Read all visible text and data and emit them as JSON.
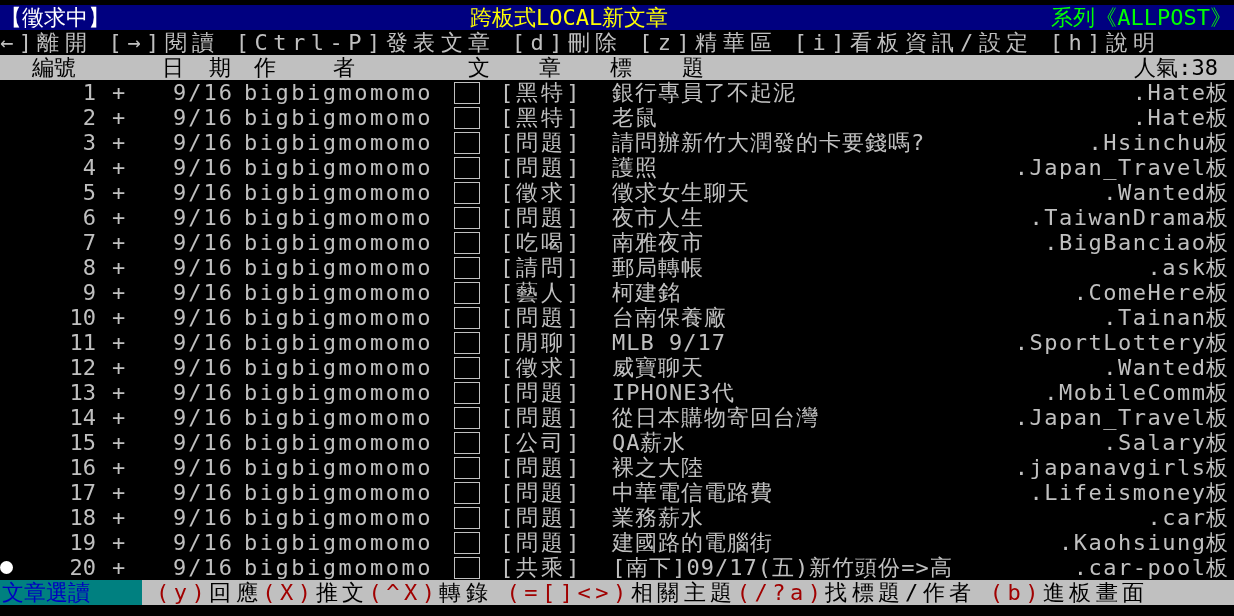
{
  "title_bar": {
    "mode": "【徵求中】",
    "title": "跨板式LOCAL新文章",
    "series": "系列《ALLPOST》"
  },
  "nav": [
    "←]離開",
    "[→]閱讀",
    "[Ctrl-P]發表文章",
    "[d]刪除",
    "[z]精華區",
    "[i]看板資訊/設定",
    "[h]說明"
  ],
  "columns": {
    "number": "編號",
    "date": "日 期",
    "author": "作 者",
    "title": "文 章 標 題",
    "popularity": "人氣:38"
  },
  "rows": [
    {
      "number": "1",
      "mark": "+",
      "date": "9/16",
      "author": "bigbigmomomo",
      "category": "[黑特]",
      "title": "銀行專員了不起泥",
      "board": ".Hate板",
      "selected": false
    },
    {
      "number": "2",
      "mark": "+",
      "date": "9/16",
      "author": "bigbigmomomo",
      "category": "[黑特]",
      "title": "老鼠",
      "board": ".Hate板",
      "selected": false
    },
    {
      "number": "3",
      "mark": "+",
      "date": "9/16",
      "author": "bigbigmomomo",
      "category": "[問題]",
      "title": "請問辦新竹大潤發的卡要錢嗎?",
      "board": ".Hsinchu板",
      "selected": false
    },
    {
      "number": "4",
      "mark": "+",
      "date": "9/16",
      "author": "bigbigmomomo",
      "category": "[問題]",
      "title": "護照",
      "board": ".Japan_Travel板",
      "selected": false
    },
    {
      "number": "5",
      "mark": "+",
      "date": "9/16",
      "author": "bigbigmomomo",
      "category": "[徵求]",
      "title": "徵求女生聊天",
      "board": ".Wanted板",
      "selected": false
    },
    {
      "number": "6",
      "mark": "+",
      "date": "9/16",
      "author": "bigbigmomomo",
      "category": "[問題]",
      "title": "夜市人生",
      "board": ".TaiwanDrama板",
      "selected": false
    },
    {
      "number": "7",
      "mark": "+",
      "date": "9/16",
      "author": "bigbigmomomo",
      "category": "[吃喝]",
      "title": "南雅夜市",
      "board": ".BigBanciao板",
      "selected": false
    },
    {
      "number": "8",
      "mark": "+",
      "date": "9/16",
      "author": "bigbigmomomo",
      "category": "[請問]",
      "title": "郵局轉帳",
      "board": ".ask板",
      "selected": false
    },
    {
      "number": "9",
      "mark": "+",
      "date": "9/16",
      "author": "bigbigmomomo",
      "category": "[藝人]",
      "title": "柯建銘",
      "board": ".ComeHere板",
      "selected": false
    },
    {
      "number": "10",
      "mark": "+",
      "date": "9/16",
      "author": "bigbigmomomo",
      "category": "[問題]",
      "title": "台南保養廠",
      "board": ".Tainan板",
      "selected": false
    },
    {
      "number": "11",
      "mark": "+",
      "date": "9/16",
      "author": "bigbigmomomo",
      "category": "[閒聊]",
      "title": "MLB 9/17",
      "board": ".SportLottery板",
      "selected": false
    },
    {
      "number": "12",
      "mark": "+",
      "date": "9/16",
      "author": "bigbigmomomo",
      "category": "[徵求]",
      "title": "威寶聊天",
      "board": ".Wanted板",
      "selected": false
    },
    {
      "number": "13",
      "mark": "+",
      "date": "9/16",
      "author": "bigbigmomomo",
      "category": "[問題]",
      "title": "IPHONE3代",
      "board": ".MobileComm板",
      "selected": false
    },
    {
      "number": "14",
      "mark": "+",
      "date": "9/16",
      "author": "bigbigmomomo",
      "category": "[問題]",
      "title": "從日本購物寄回台灣",
      "board": ".Japan_Travel板",
      "selected": false
    },
    {
      "number": "15",
      "mark": "+",
      "date": "9/16",
      "author": "bigbigmomomo",
      "category": "[公司]",
      "title": "QA薪水",
      "board": ".Salary板",
      "selected": false
    },
    {
      "number": "16",
      "mark": "+",
      "date": "9/16",
      "author": "bigbigmomomo",
      "category": "[問題]",
      "title": "裸之大陸",
      "board": ".japanavgirls板",
      "selected": false
    },
    {
      "number": "17",
      "mark": "+",
      "date": "9/16",
      "author": "bigbigmomomo",
      "category": "[問題]",
      "title": "中華電信電路費",
      "board": ".Lifeismoney板",
      "selected": false
    },
    {
      "number": "18",
      "mark": "+",
      "date": "9/16",
      "author": "bigbigmomomo",
      "category": "[問題]",
      "title": "業務薪水",
      "board": ".car板",
      "selected": false
    },
    {
      "number": "19",
      "mark": "+",
      "date": "9/16",
      "author": "bigbigmomomo",
      "category": "[問題]",
      "title": "建國路的電腦街",
      "board": ".Kaohsiung板",
      "selected": false
    },
    {
      "number": "20",
      "mark": "+",
      "date": "9/16",
      "author": "bigbigmomomo",
      "category": "[共乘]",
      "title": "[南下]09/17(五)新竹頭份=>高",
      "board": ".car-pool板",
      "selected": true
    }
  ],
  "footer": {
    "mode": "文章選讀",
    "commands": [
      {
        "key": "(y)",
        "label": "回應"
      },
      {
        "key": "(X)",
        "label": "推文"
      },
      {
        "key": "(^X)",
        "label": "轉錄"
      },
      {
        "key": "(=[]<>)",
        "label": "相關主題"
      },
      {
        "key": "(/?a)",
        "label": "找標題/作者"
      },
      {
        "key": "(b)",
        "label": "進板畫面"
      }
    ]
  }
}
